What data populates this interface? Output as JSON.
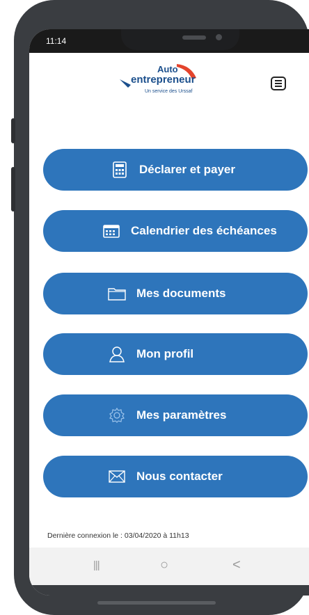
{
  "status_bar": {
    "time": "11:14"
  },
  "header": {
    "logo": {
      "line1": "Auto",
      "line2": "entrepreneur",
      "tagline": "Un service des Urssaf"
    },
    "menu_icon": "hamburger-icon"
  },
  "menu": {
    "items": [
      {
        "label": "Déclarer et payer",
        "icon": "calculator-icon"
      },
      {
        "label": "Calendrier des échéances",
        "icon": "calendar-icon"
      },
      {
        "label": "Mes documents",
        "icon": "folder-icon"
      },
      {
        "label": "Mon profil",
        "icon": "user-icon"
      },
      {
        "label": "Mes paramètres",
        "icon": "gear-icon"
      },
      {
        "label": "Nous contacter",
        "icon": "envelope-icon"
      }
    ]
  },
  "footer": {
    "last_login": "Dernière connexion le : 03/04/2020 à 11h13"
  },
  "android_nav": {
    "recents": "|||",
    "home": "○",
    "back": "<"
  },
  "colors": {
    "button_blue": "#2e75bb",
    "logo_blue": "#1b4f8c",
    "logo_red": "#e4442c",
    "frame": "#3a3d41"
  }
}
